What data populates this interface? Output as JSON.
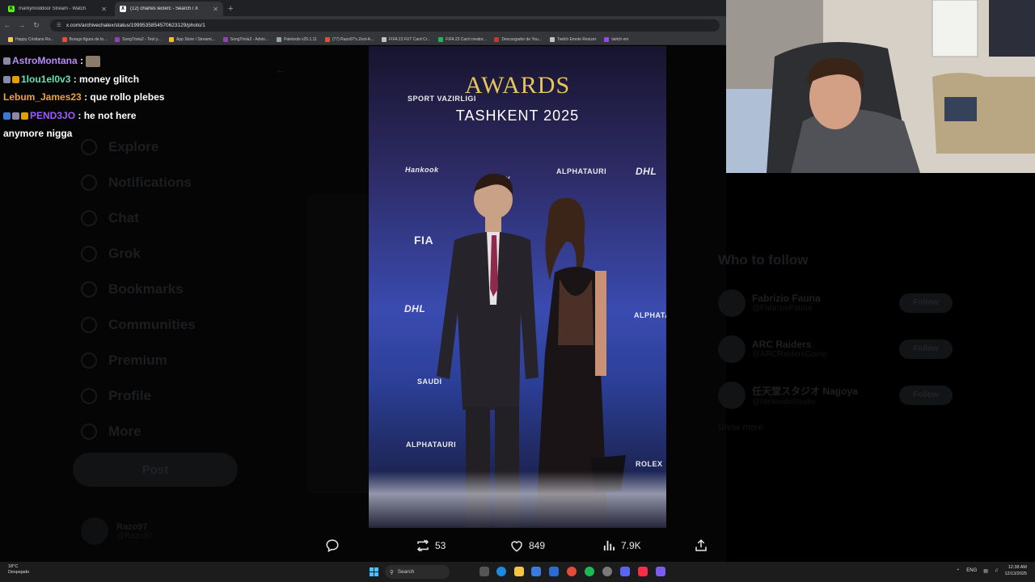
{
  "browser": {
    "tabs": [
      {
        "title": "markymoddoor Stream - Watch",
        "active": false,
        "favicon_color": "#53fc18",
        "favicon_letter": "K"
      },
      {
        "title": "(12) charles leclerc - Search / X",
        "active": true,
        "favicon_color": "#ffffff",
        "favicon_letter": "X"
      }
    ],
    "url": "x.com/archivechalex/status/1999535854570623129/photo/1",
    "bookmarks": [
      {
        "label": "Happy Cristiano Ro...",
        "color": "#f4d03f"
      },
      {
        "label": "Burago figura de to...",
        "color": "#e74c3c"
      },
      {
        "label": "SongTrivia2 - Test y...",
        "color": "#8e44ad"
      },
      {
        "label": "App Store / Streami...",
        "color": "#f1c40f"
      },
      {
        "label": "SongTrivia2 - Advin...",
        "color": "#8e44ad"
      },
      {
        "label": "Paletools v25.1.11",
        "color": "#95a5a6"
      },
      {
        "label": "(77) Razo97's Zest-A...",
        "color": "#e74c3c"
      },
      {
        "label": "FIFA 23 FUT Card Cr...",
        "color": "#bdc3c7"
      },
      {
        "label": "FIFA 23 Card creator...",
        "color": "#27ae60"
      },
      {
        "label": "Descargador de You...",
        "color": "#c0392b"
      },
      {
        "label": "Twitch Emote Resizer",
        "color": "#bdc3c7"
      },
      {
        "label": "twitch em",
        "color": "#9146ff"
      }
    ]
  },
  "chat": [
    {
      "user": "AstroMontana",
      "message": "",
      "badges": [
        "#8a8aa8"
      ],
      "emote": true,
      "color_class": "u1"
    },
    {
      "user": "1lou1el0v3",
      "message": "money glitch",
      "badges": [
        "#8a8aa8",
        "#e0a000"
      ],
      "emote": false,
      "color_class": "u2"
    },
    {
      "user": "Lebum_James23",
      "message": "que rollo plebes",
      "badges": [],
      "emote": false,
      "color_class": "u3"
    },
    {
      "user": "PEND3JO",
      "message": "he not here",
      "badges": [
        "#3a7bd5",
        "#8a8aa8",
        "#e0a000"
      ],
      "emote": false,
      "color_class": "u4"
    },
    {
      "user": "",
      "message": "anymore nigga",
      "badges": [],
      "emote": false,
      "color_class": "u4"
    }
  ],
  "x_background": {
    "nav": [
      "Explore",
      "Notifications",
      "Chat",
      "Grok",
      "Bookmarks",
      "Communities",
      "Premium",
      "Profile",
      "More"
    ],
    "post_button": "Post",
    "user_name": "Razo97",
    "user_handle": "@Razo97",
    "who_to_follow_title": "Who to follow",
    "follow_suggestions": [
      {
        "name": "Fabrizio Fauna",
        "handle": "@FabrizioFauna"
      },
      {
        "name": "ARC Raiders",
        "handle": "@ARCRaidersGame"
      },
      {
        "name": "任天堂スタジオ Nagoya",
        "handle": "@NintendoStudio"
      }
    ],
    "follow_label": "Follow",
    "show_more": "Show more"
  },
  "photo": {
    "headline": "AWARDS",
    "subheadline": "TASHKENT 2025",
    "sponsors": [
      "SPORT VAZIRLIGI",
      "Hankook",
      "ROLEX",
      "ALPHATAURI",
      "DHL",
      "FIA",
      "ALPHATAURI",
      "DHL",
      "SAUDI",
      "ALPHATAURI",
      "ROLEX"
    ]
  },
  "post_actions": {
    "reply_count": "",
    "repost_count": "53",
    "like_count": "849",
    "views_count": "7.9K"
  },
  "taskbar": {
    "weather_temp": "18°C",
    "weather_desc": "Despejado",
    "search_label": "Search",
    "language": "ENG",
    "time": "12:38 AM",
    "date": "12/13/2025"
  }
}
